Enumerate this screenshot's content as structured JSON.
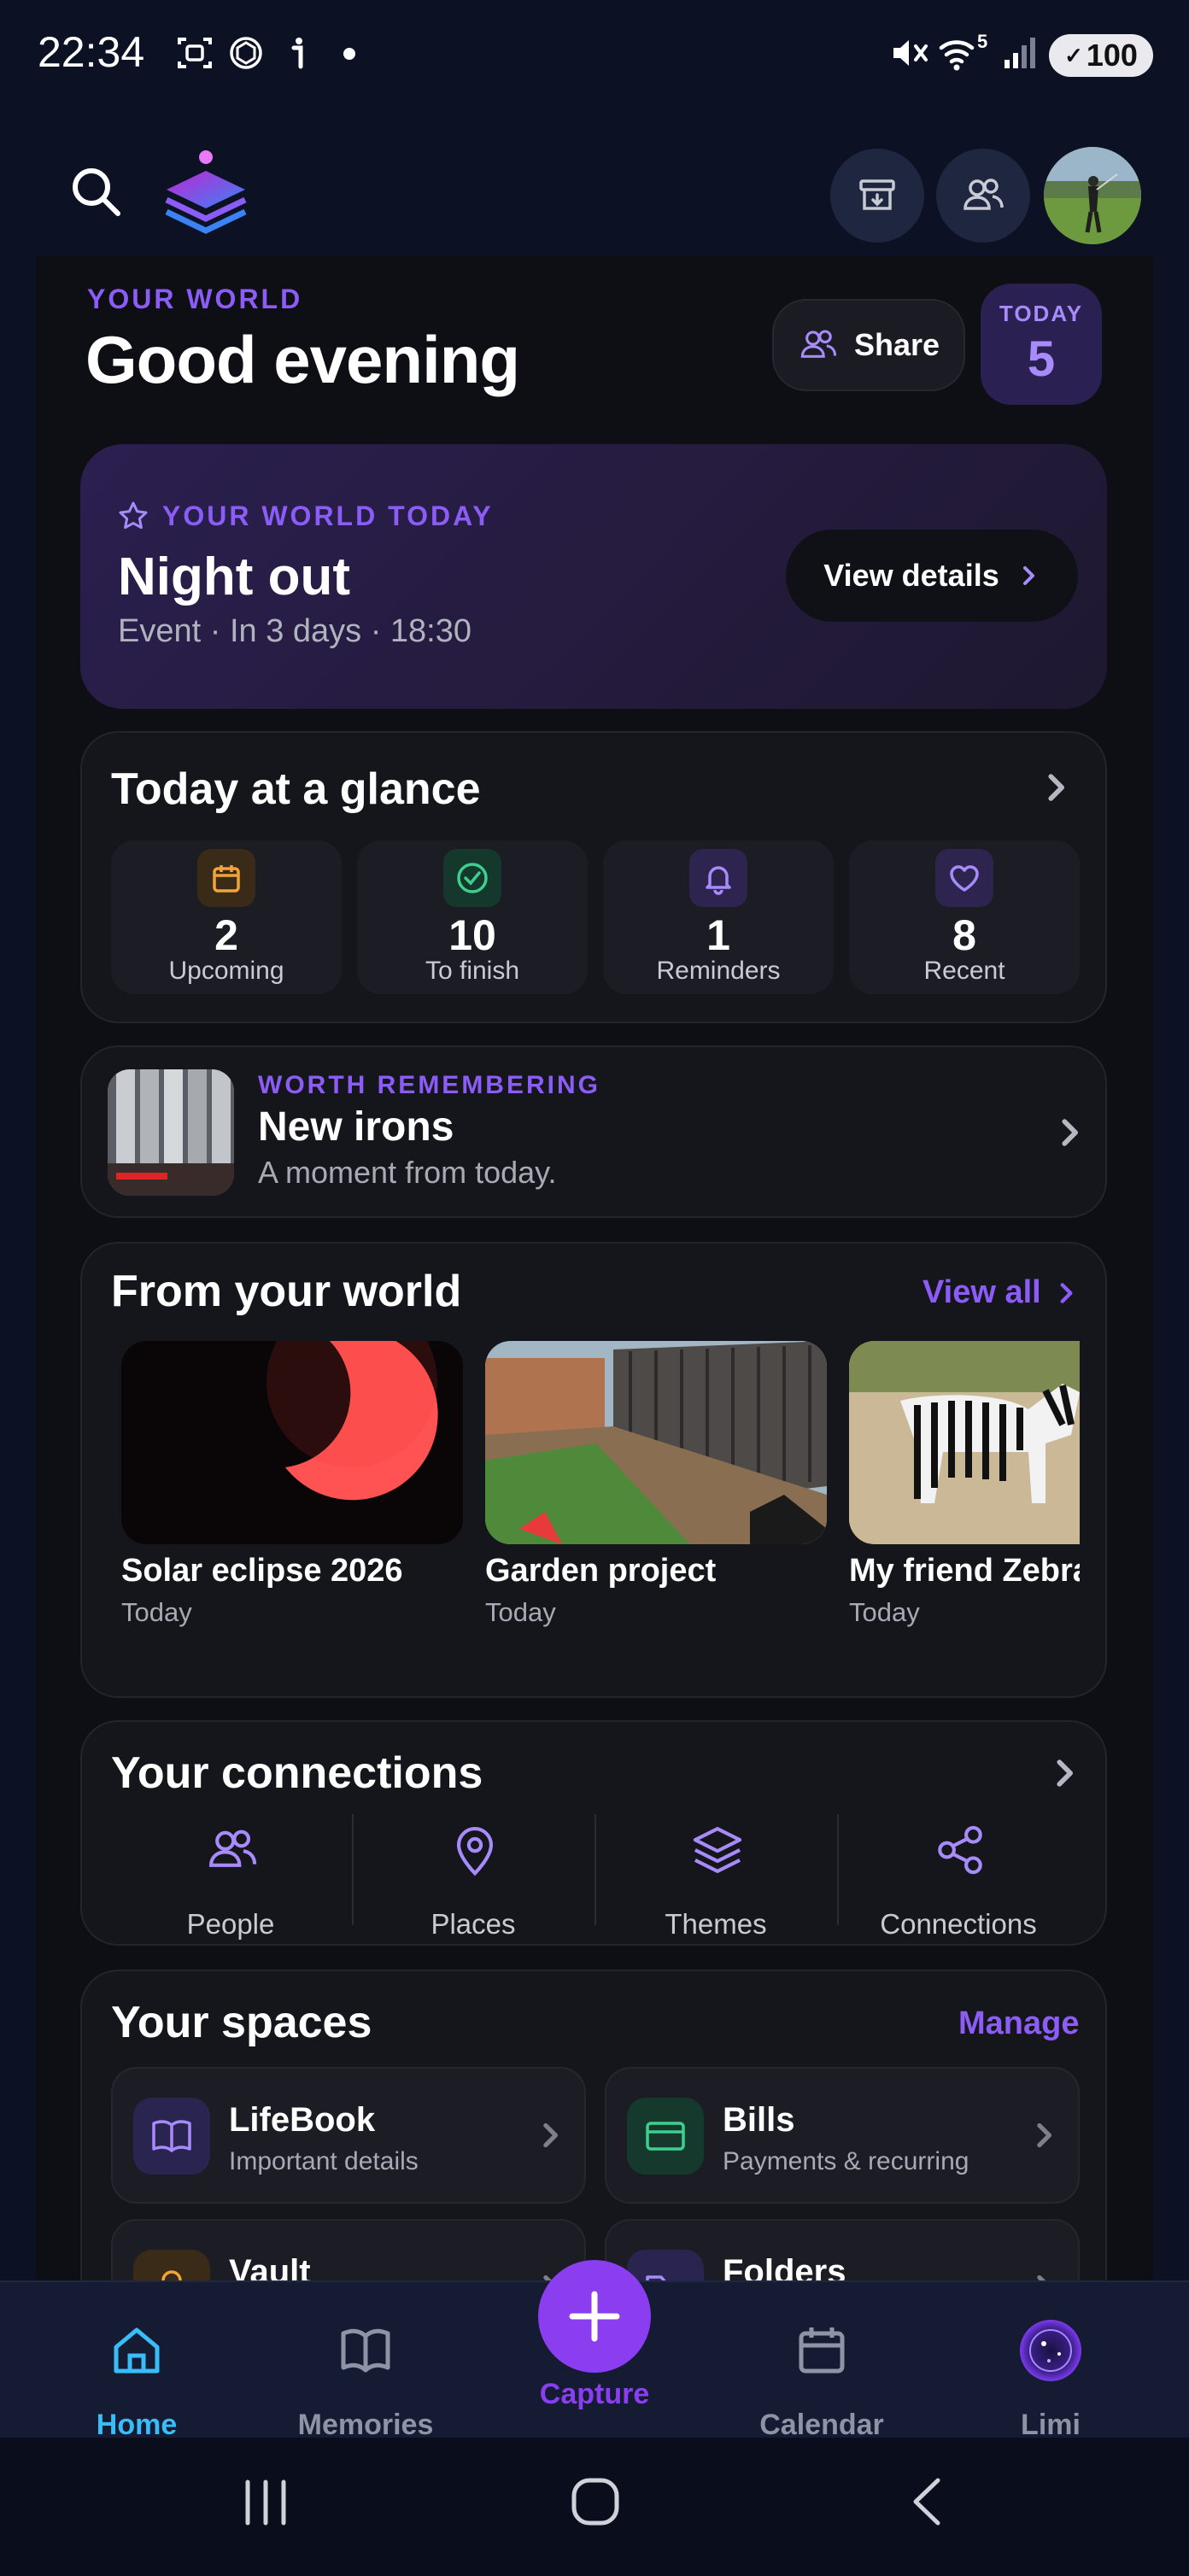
{
  "status_bar": {
    "time": "22:34",
    "battery": "100",
    "wifi_badge": "5",
    "icons": [
      "screenshot-icon",
      "chatgpt-icon",
      "info-icon",
      "dot-icon",
      "mute-icon",
      "wifi-icon",
      "signal-icon",
      "battery-icon"
    ]
  },
  "header": {
    "kicker": "YOUR WORLD",
    "greeting": "Good evening",
    "share_label": "Share",
    "today_label": "TODAY",
    "today_count": "5"
  },
  "highlight": {
    "kicker": "YOUR WORLD TODAY",
    "title": "Night out",
    "subtitle": "Event · In 3 days · 18:30",
    "button": "View details"
  },
  "glance": {
    "title": "Today at a glance",
    "items": [
      {
        "value": "2",
        "label": "Upcoming",
        "icon": "calendar-icon",
        "color": "#f0a43a"
      },
      {
        "value": "10",
        "label": "To finish",
        "icon": "check-circle-icon",
        "color": "#3ecf8e"
      },
      {
        "value": "1",
        "label": "Reminders",
        "icon": "bell-icon",
        "color": "#a78bfa"
      },
      {
        "value": "8",
        "label": "Recent",
        "icon": "heart-icon",
        "color": "#a78bfa"
      }
    ]
  },
  "remember": {
    "kicker": "WORTH REMEMBERING",
    "title": "New irons",
    "subtitle": "A moment from today."
  },
  "world": {
    "title": "From your world",
    "view_all": "View all",
    "items": [
      {
        "title": "Solar eclipse 2026",
        "date": "Today"
      },
      {
        "title": "Garden project",
        "date": "Today"
      },
      {
        "title": "My friend Zebra",
        "date": "Today"
      }
    ]
  },
  "connections": {
    "title": "Your connections",
    "items": [
      {
        "label": "People",
        "icon": "people-icon"
      },
      {
        "label": "Places",
        "icon": "map-pin-icon"
      },
      {
        "label": "Themes",
        "icon": "layers-icon"
      },
      {
        "label": "Connections",
        "icon": "share-nodes-icon"
      }
    ]
  },
  "spaces": {
    "title": "Your spaces",
    "manage": "Manage",
    "items": [
      {
        "title": "LifeBook",
        "subtitle": "Important details",
        "icon": "book-icon",
        "color": "#8b5cf6"
      },
      {
        "title": "Bills",
        "subtitle": "Payments & recurring",
        "icon": "credit-card-icon",
        "color": "#3ecf8e"
      },
      {
        "title": "Vault",
        "subtitle": "",
        "icon": "lock-icon",
        "color": "#f0a43a"
      },
      {
        "title": "Folders",
        "subtitle": "",
        "icon": "folder-icon",
        "color": "#8b5cf6"
      }
    ]
  },
  "nav": {
    "items": [
      {
        "label": "Home",
        "icon": "home-icon",
        "active": true
      },
      {
        "label": "Memories",
        "icon": "book-open-icon",
        "active": false
      },
      {
        "label": "Capture",
        "icon": "plus-icon",
        "active": false
      },
      {
        "label": "Calendar",
        "icon": "calendar-icon",
        "active": false
      },
      {
        "label": "Limi",
        "icon": "limi-orb-icon",
        "active": false
      }
    ]
  },
  "colors": {
    "accent": "#8b5cf6",
    "active_nav": "#38bdf8",
    "background": "#0c1224"
  }
}
